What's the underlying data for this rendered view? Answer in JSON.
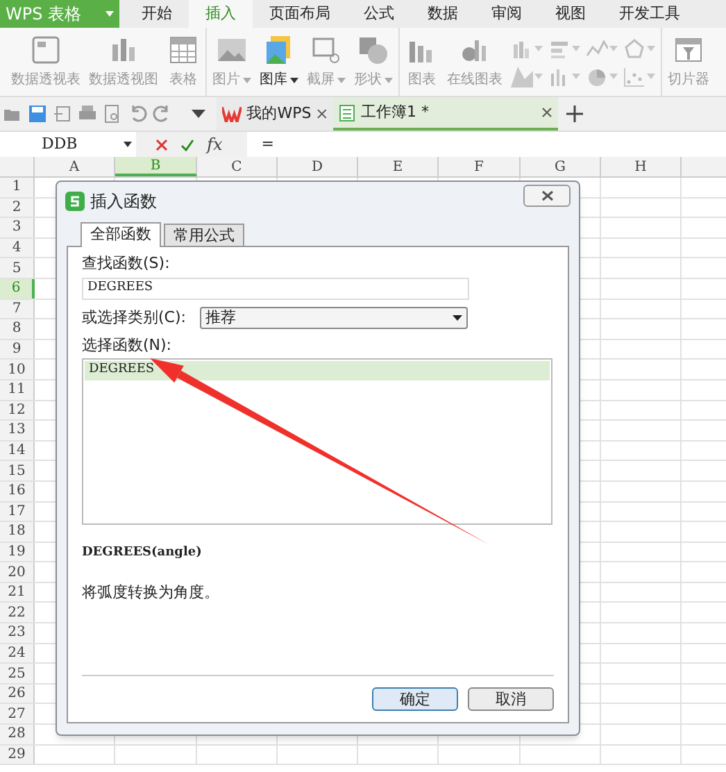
{
  "app_menu": {
    "label": "WPS 表格"
  },
  "menu_tabs": [
    {
      "label": "开始",
      "selected": false
    },
    {
      "label": "插入",
      "selected": true
    },
    {
      "label": "页面布局",
      "selected": false
    },
    {
      "label": "公式",
      "selected": false
    },
    {
      "label": "数据",
      "selected": false
    },
    {
      "label": "审阅",
      "selected": false
    },
    {
      "label": "视图",
      "selected": false
    },
    {
      "label": "开发工具",
      "selected": false
    }
  ],
  "ribbon_groups": [
    {
      "buttons": [
        {
          "kind": "large",
          "label": "数据透视表",
          "disabled": true,
          "dropdown": false
        },
        {
          "kind": "large",
          "label": "数据透视图",
          "disabled": true,
          "dropdown": false
        },
        {
          "kind": "large",
          "label": "表格",
          "disabled": true,
          "dropdown": false
        }
      ]
    },
    {
      "buttons": [
        {
          "kind": "large",
          "label": "图片",
          "disabled": true,
          "dropdown": true
        },
        {
          "kind": "large",
          "label": "图库",
          "disabled": false,
          "dropdown": true
        },
        {
          "kind": "large",
          "label": "截屏",
          "disabled": true,
          "dropdown": true
        },
        {
          "kind": "large",
          "label": "形状",
          "disabled": true,
          "dropdown": true
        }
      ]
    },
    {
      "buttons": [
        {
          "kind": "large",
          "label": "图表",
          "disabled": true,
          "dropdown": false
        },
        {
          "kind": "large",
          "label": "在线图表",
          "disabled": true,
          "dropdown": false
        },
        {
          "kind": "small",
          "disabled": true,
          "dropdown": true
        },
        {
          "kind": "small",
          "disabled": true,
          "dropdown": true
        },
        {
          "kind": "small",
          "disabled": true,
          "dropdown": true
        },
        {
          "kind": "small",
          "disabled": true,
          "dropdown": true
        },
        {
          "kind": "small",
          "disabled": true,
          "dropdown": true
        },
        {
          "kind": "small",
          "disabled": true,
          "dropdown": true
        },
        {
          "kind": "small",
          "disabled": true,
          "dropdown": true
        },
        {
          "kind": "small",
          "disabled": true,
          "dropdown": true
        }
      ]
    },
    {
      "buttons": [
        {
          "kind": "large",
          "label": "切片器",
          "disabled": true,
          "dropdown": false
        }
      ]
    }
  ],
  "doc_tabs": [
    {
      "kind": "home",
      "label": "我的WPS",
      "selected": false
    },
    {
      "kind": "sheet",
      "label": "工作簿1 *",
      "selected": true
    }
  ],
  "formula_bar": {
    "name_box": "DDB",
    "function_button": "fx",
    "value": "="
  },
  "sheet": {
    "columns": [
      {
        "label": "A",
        "selected": false
      },
      {
        "label": "B",
        "selected": true
      },
      {
        "label": "C",
        "selected": false
      },
      {
        "label": "D",
        "selected": false
      },
      {
        "label": "E",
        "selected": false
      },
      {
        "label": "F",
        "selected": false
      },
      {
        "label": "G",
        "selected": false
      },
      {
        "label": "H",
        "selected": false
      }
    ],
    "rows": [
      {
        "label": "1",
        "selected": false
      },
      {
        "label": "2",
        "selected": false
      },
      {
        "label": "3",
        "selected": false
      },
      {
        "label": "4",
        "selected": false
      },
      {
        "label": "5",
        "selected": false
      },
      {
        "label": "6",
        "selected": true
      },
      {
        "label": "7",
        "selected": false
      },
      {
        "label": "8",
        "selected": false
      },
      {
        "label": "9",
        "selected": false
      },
      {
        "label": "10",
        "selected": false
      },
      {
        "label": "11",
        "selected": false
      },
      {
        "label": "12",
        "selected": false
      },
      {
        "label": "13",
        "selected": false
      },
      {
        "label": "14",
        "selected": false
      },
      {
        "label": "15",
        "selected": false
      },
      {
        "label": "16",
        "selected": false
      },
      {
        "label": "17",
        "selected": false
      },
      {
        "label": "18",
        "selected": false
      },
      {
        "label": "19",
        "selected": false
      },
      {
        "label": "20",
        "selected": false
      },
      {
        "label": "21",
        "selected": false
      },
      {
        "label": "22",
        "selected": false
      },
      {
        "label": "23",
        "selected": false
      },
      {
        "label": "24",
        "selected": false
      },
      {
        "label": "25",
        "selected": false
      },
      {
        "label": "26",
        "selected": false
      },
      {
        "label": "27",
        "selected": false
      },
      {
        "label": "28",
        "selected": false
      },
      {
        "label": "29",
        "selected": false
      }
    ]
  },
  "dialog": {
    "title": "插入函数",
    "tabs": [
      {
        "label": "全部函数",
        "selected": true
      },
      {
        "label": "常用公式",
        "selected": false
      }
    ],
    "search_label": "查找函数(S):",
    "search_value": "DEGREES",
    "category_label": "或选择类别(C):",
    "category_value": "推荐",
    "list_label": "选择函数(N):",
    "functions": [
      {
        "name": "DEGREES",
        "selected": true
      }
    ],
    "signature": "DEGREES(angle)",
    "description": "将弧度转换为角度。",
    "buttons": [
      {
        "kind": "primary",
        "label": "确定"
      },
      {
        "kind": "secondary",
        "label": "取消"
      }
    ]
  }
}
